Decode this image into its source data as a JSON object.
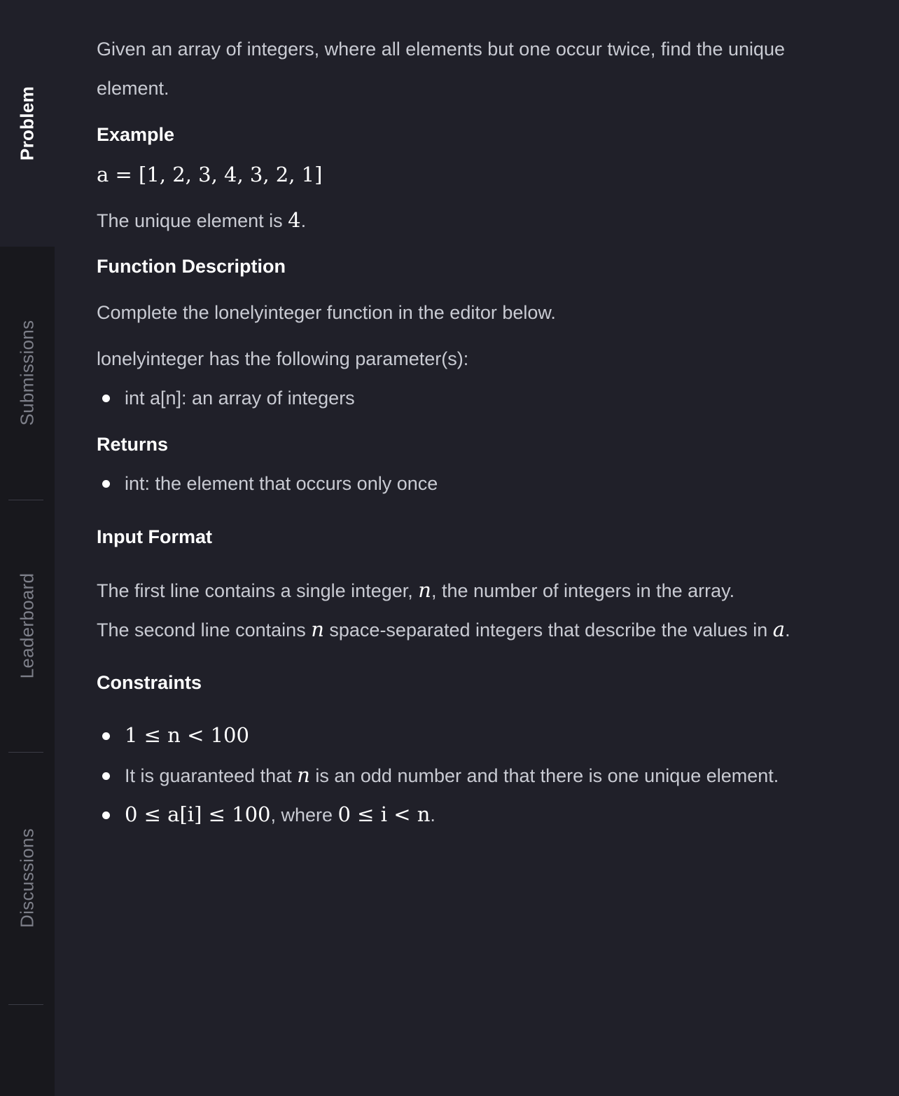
{
  "sidebar": {
    "tabs": [
      {
        "label": "Problem"
      },
      {
        "label": "Submissions"
      },
      {
        "label": "Leaderboard"
      },
      {
        "label": "Discussions"
      }
    ]
  },
  "problem": {
    "intro_line1": "Given an array of integers, where all elements but one occur twice, find the unique",
    "intro_line2": "element.",
    "example_heading": "Example",
    "example_formula": "a = [1, 2, 3, 4, 3, 2, 1]",
    "example_result_prefix": "The unique element is ",
    "example_result_value": "4",
    "function_description_heading": "Function Description",
    "function_description_text": "Complete the lonelyinteger function in the editor below.",
    "parameters_intro": "lonelyinteger has the following parameter(s):",
    "parameters": [
      "int a[n]: an array of integers"
    ],
    "returns_heading": "Returns",
    "returns": [
      "int: the element that occurs only once"
    ],
    "input_format_heading": "Input Format",
    "input_line1_prefix": "The first line contains a single integer, ",
    "input_line1_var": "n",
    "input_line1_suffix": ", the number of integers in the array.",
    "input_line2_prefix": "The second line contains ",
    "input_line2_var": "n",
    "input_line2_middle": " space-separated integers that describe the values in ",
    "input_line2_var2": "a",
    "input_line2_suffix": ".",
    "constraints_heading": "Constraints",
    "constraint1_formula": "1 ≤ n < 100",
    "constraint2_prefix": "It is guaranteed that ",
    "constraint2_var": "n",
    "constraint2_suffix": " is an odd number and that there is one unique element.",
    "constraint3_formula": "0 ≤ a[i] ≤ 100",
    "constraint3_middle": ", where ",
    "constraint3_formula2": "0 ≤ i < n",
    "constraint3_suffix": "."
  }
}
